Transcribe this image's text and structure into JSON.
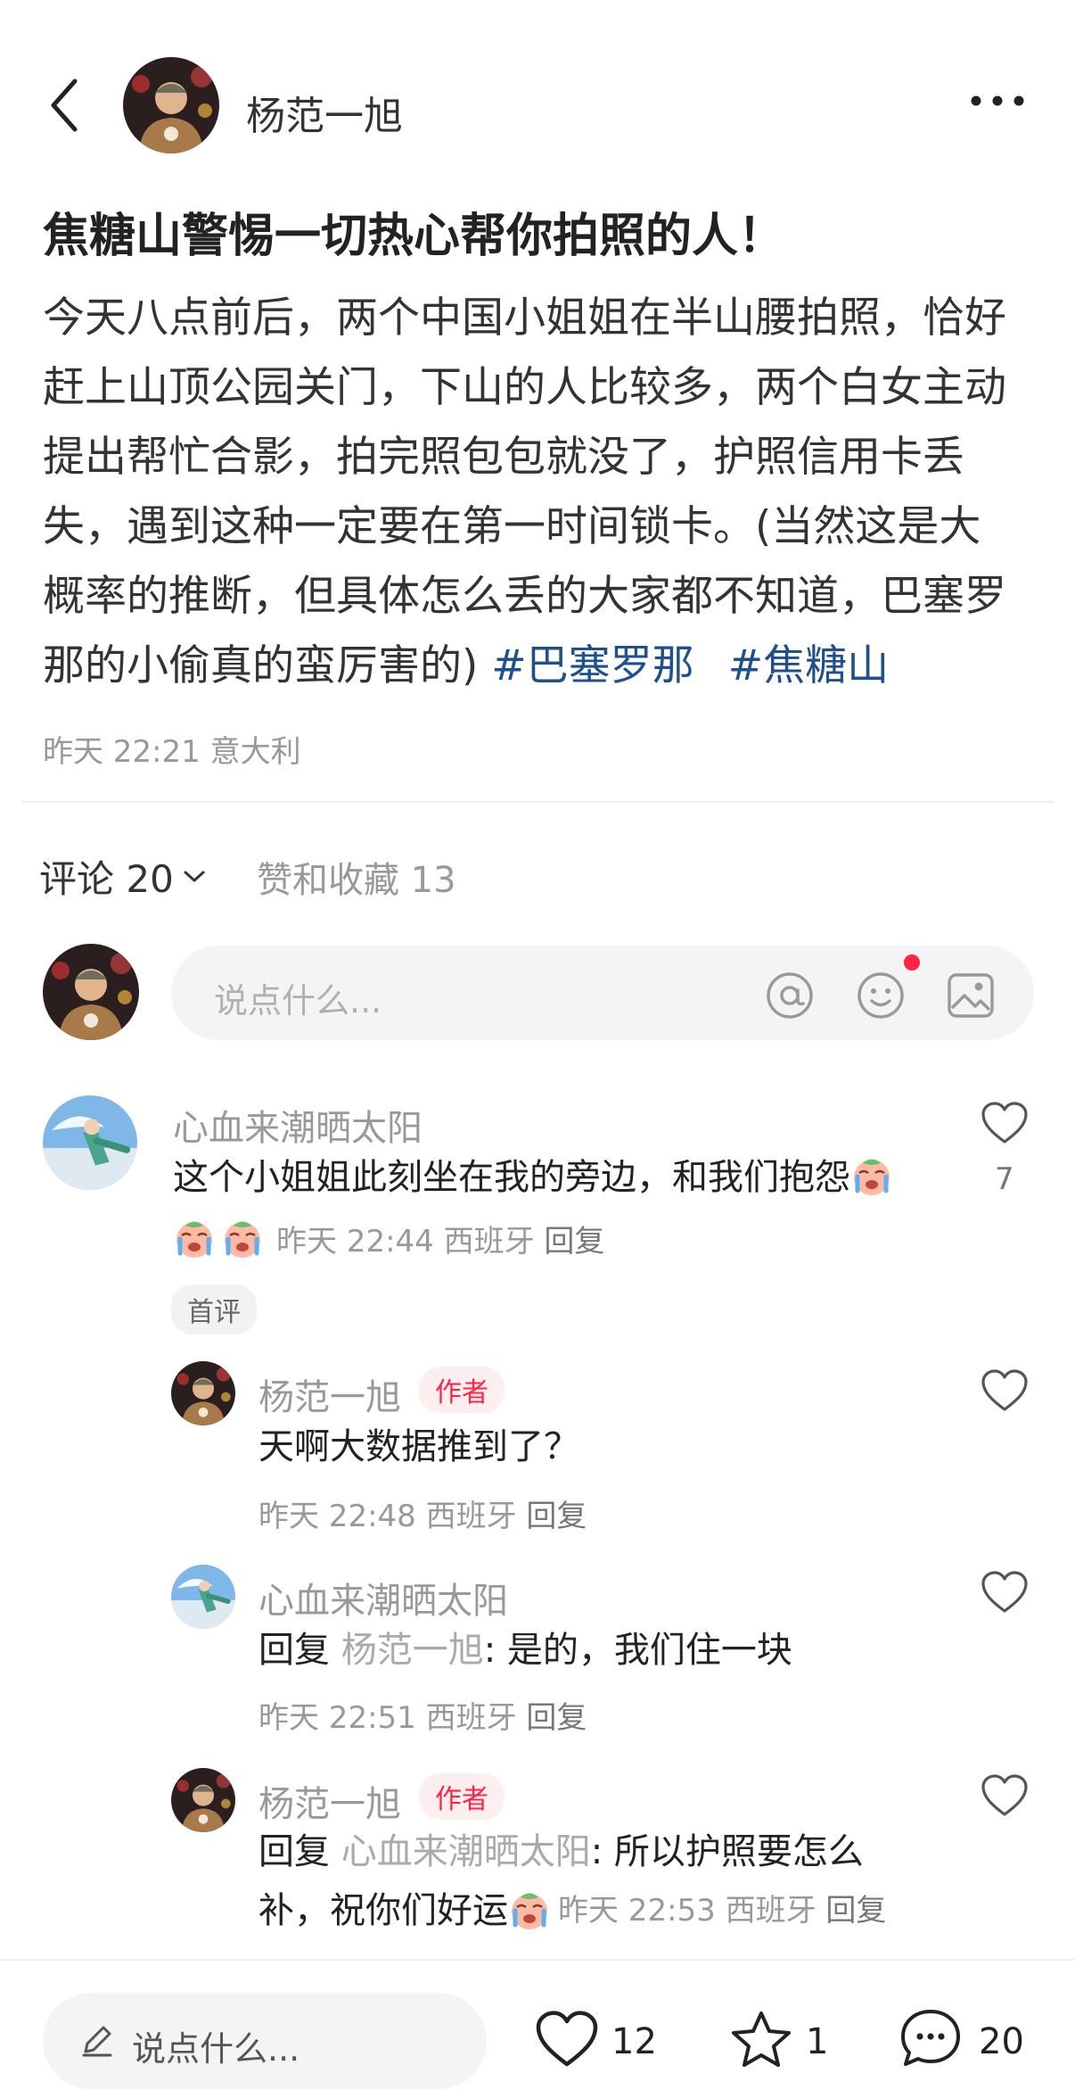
{
  "header": {
    "author_name": "杨范一旭",
    "back_icon": "chevron-left-icon",
    "more_icon": "more-horizontal-icon"
  },
  "post": {
    "title": "焦糖山警惕一切热心帮你拍照的人！",
    "body_lines": [
      "今天八点前后，两个中国小姐姐在半山腰拍照，恰好",
      "赶上山顶公园关门，下山的人比较多，两个白女主动",
      "提出帮忙合影，拍完照包包就没了，护照信用卡丢",
      "失，遇到这种一定要在第一时间锁卡。(当然这是大",
      "概率的推断，但具体怎么丢的大家都不知道，巴塞罗",
      "那的小偷真的蛮厉害的)"
    ],
    "hashtags": [
      "#巴塞罗那",
      "#焦糖山"
    ],
    "meta": "昨天 22:21 意大利"
  },
  "tabs": {
    "comments_label": "评论 20",
    "likes_label": "赞和收藏 13"
  },
  "comment_input": {
    "placeholder": "说点什么..."
  },
  "comments": [
    {
      "name": "心血来潮晒太阳",
      "text": "这个小姐姐此刻坐在我的旁边，和我们抱怨",
      "time": "昨天 22:44 西班牙",
      "reply": "回复",
      "badge": "首评",
      "likes": "7"
    },
    {
      "name": "杨范一旭",
      "author_badge": "作者",
      "text": "天啊大数据推到了？",
      "time": "昨天 22:48 西班牙",
      "reply": "回复"
    },
    {
      "name": "心血来潮晒太阳",
      "reply_prefix": "回复",
      "reply_to": "杨范一旭",
      "text": ": 是的，我们住一块",
      "time": "昨天 22:51 西班牙",
      "reply": "回复"
    },
    {
      "name": "杨范一旭",
      "author_badge": "作者",
      "reply_prefix": "回复",
      "reply_to": "心血来潮晒太阳",
      "text_line1": ": 所以护照要怎么",
      "text_line2": "补，祝你们好运",
      "time": "昨天 22:53 西班牙",
      "reply": "回复"
    }
  ],
  "bottom_bar": {
    "input_placeholder": "说点什么...",
    "like_count": "12",
    "star_count": "1",
    "comment_count": "20"
  },
  "colors": {
    "accent_red": "#ff2442",
    "hashtag_blue": "#1f4f8c"
  }
}
